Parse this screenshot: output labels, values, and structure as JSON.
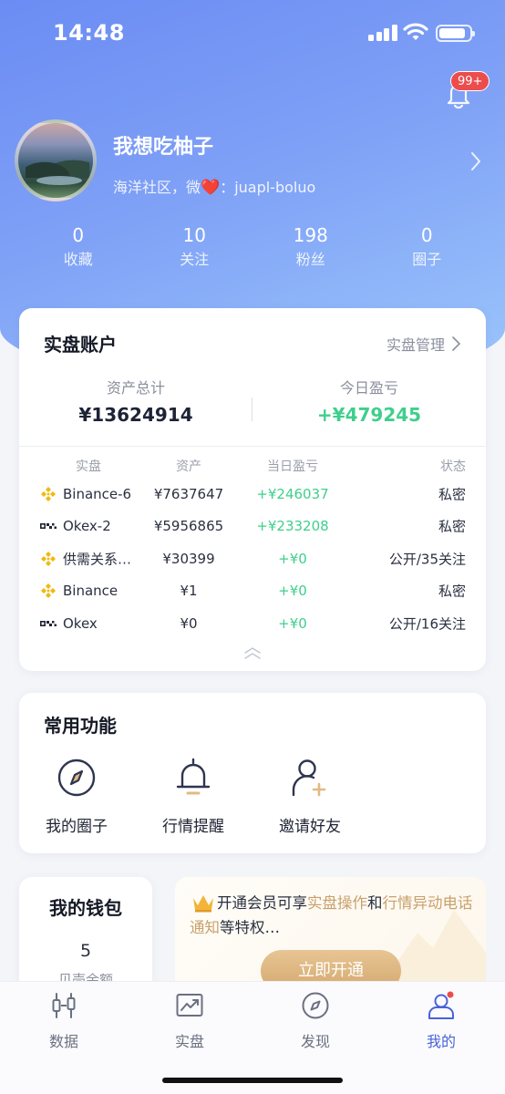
{
  "status_bar": {
    "time": "14:48"
  },
  "notifications": {
    "badge": "99+"
  },
  "profile": {
    "name": "我想吃柚子",
    "bio_prefix": "海洋社区，微",
    "bio_suffix": "：juapl-boluo"
  },
  "stats": [
    {
      "value": "0",
      "label": "收藏"
    },
    {
      "value": "10",
      "label": "关注"
    },
    {
      "value": "198",
      "label": "粉丝"
    },
    {
      "value": "0",
      "label": "圈子"
    }
  ],
  "account": {
    "title": "实盘账户",
    "manage_label": "实盘管理",
    "total_label": "资产总计",
    "total_value": "¥13624914",
    "today_label": "今日盈亏",
    "today_value": "+¥479245",
    "columns": [
      "实盘",
      "资产",
      "当日盈亏",
      "状态"
    ],
    "rows": [
      {
        "exchange": "Binance-6",
        "icon": "binance-icon",
        "asset": "¥7637647",
        "pnl": "+¥246037",
        "status": "私密"
      },
      {
        "exchange": "Okex-2",
        "icon": "okex-icon",
        "asset": "¥5956865",
        "pnl": "+¥233208",
        "status": "私密"
      },
      {
        "exchange": "供需关系…",
        "icon": "binance-icon",
        "asset": "¥30399",
        "pnl": "+¥0",
        "status": "公开/35关注"
      },
      {
        "exchange": "Binance",
        "icon": "binance-icon",
        "asset": "¥1",
        "pnl": "+¥0",
        "status": "私密"
      },
      {
        "exchange": "Okex",
        "icon": "okex-icon",
        "asset": "¥0",
        "pnl": "+¥0",
        "status": "公开/16关注"
      }
    ]
  },
  "functions": {
    "title": "常用功能",
    "items": [
      {
        "label": "我的圈子",
        "icon": "compass-circle-icon"
      },
      {
        "label": "行情提醒",
        "icon": "bell-icon"
      },
      {
        "label": "邀请好友",
        "icon": "add-user-icon"
      }
    ]
  },
  "wallet": {
    "title": "我的钱包",
    "value": "5",
    "label": "贝壳余额"
  },
  "vip": {
    "text_before": "开通会员可享",
    "highlight_1": "实盘操作",
    "text_and": "和",
    "highlight_2": "行情异动电话通知",
    "text_after": "等特权…",
    "button": "立即开通"
  },
  "tabbar": [
    {
      "label": "数据",
      "icon": "candlestick-icon",
      "active": false
    },
    {
      "label": "实盘",
      "icon": "chart-icon",
      "active": false
    },
    {
      "label": "发现",
      "icon": "compass-icon",
      "active": false
    },
    {
      "label": "我的",
      "icon": "user-icon",
      "active": true
    }
  ],
  "colors": {
    "accent": "#4a63d8",
    "profit": "#3fcf8c",
    "gold": "#c9a06b",
    "badge": "#ec4c4c"
  }
}
